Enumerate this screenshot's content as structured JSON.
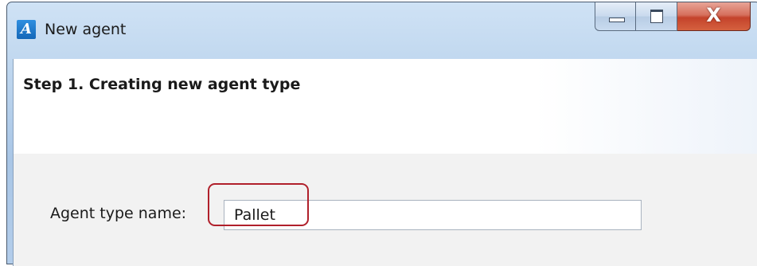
{
  "window": {
    "title": "New agent",
    "app_icon": {
      "name": "anylogic-icon",
      "glyph": "A"
    },
    "controls": {
      "minimize_icon": "minimize-icon",
      "maximize_icon": "maximize-icon",
      "close_glyph": "X"
    }
  },
  "wizard": {
    "step_title": "Step 1. Creating new agent type"
  },
  "form": {
    "agent_type_name_label": "Agent type name:",
    "agent_type_name_value": "Pallet"
  },
  "colors": {
    "highlight": "#b0202b",
    "titlebar": "#b9d2ec",
    "close_button": "#c4432b"
  }
}
